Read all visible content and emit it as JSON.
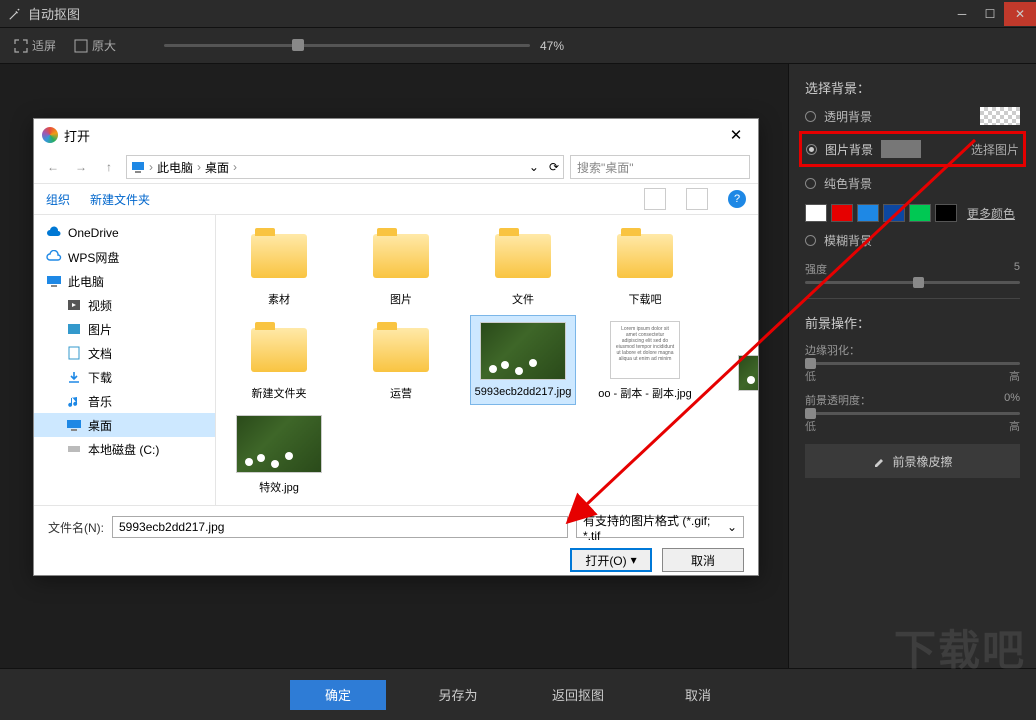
{
  "titlebar": {
    "title": "自动抠图"
  },
  "toolbar": {
    "fit": "适屏",
    "original": "原大",
    "zoom": "47%"
  },
  "sidepanel": {
    "select_bg_label": "选择背景：",
    "transparent": "透明背景",
    "image_bg": "图片背景",
    "select_image_btn": "选择图片",
    "solid_bg": "纯色背景",
    "more_colors": "更多颜色",
    "blur_bg": "模糊背景",
    "intensity_label": "强度",
    "intensity_value": "5",
    "foreground_label": "前景操作：",
    "feather_label": "边缘羽化：",
    "low": "低",
    "high": "高",
    "opacity_label": "前景透明度：",
    "opacity_value": "0%",
    "eraser_btn": "前景橡皮擦",
    "colors": [
      "#ffffff",
      "#e60000",
      "#1e88e5",
      "#0d47a1",
      "#00c853",
      "#000000"
    ]
  },
  "bottombar": {
    "ok": "确定",
    "saveas": "另存为",
    "back": "返回抠图",
    "cancel": "取消"
  },
  "watermark": "下载吧",
  "filedialog": {
    "title": "打开",
    "breadcrumb": [
      "此电脑",
      "桌面"
    ],
    "search_placeholder": "搜索\"桌面\"",
    "organize": "组织",
    "newfolder": "新建文件夹",
    "tree": [
      {
        "label": "OneDrive",
        "icon": "cloud-blue",
        "sub": false
      },
      {
        "label": "WPS网盘",
        "icon": "cloud-outline",
        "sub": false
      },
      {
        "label": "此电脑",
        "icon": "pc",
        "sub": false
      },
      {
        "label": "视频",
        "icon": "video",
        "sub": true
      },
      {
        "label": "图片",
        "icon": "images",
        "sub": true
      },
      {
        "label": "文档",
        "icon": "doc",
        "sub": true
      },
      {
        "label": "下载",
        "icon": "download",
        "sub": true
      },
      {
        "label": "音乐",
        "icon": "music",
        "sub": true
      },
      {
        "label": "桌面",
        "icon": "desktop",
        "sub": true,
        "selected": true
      },
      {
        "label": "本地磁盘 (C:)",
        "icon": "disk",
        "sub": true
      }
    ],
    "files": [
      {
        "name": "素材",
        "type": "folder"
      },
      {
        "name": "图片",
        "type": "folder"
      },
      {
        "name": "文件",
        "type": "folder"
      },
      {
        "name": "下载吧",
        "type": "folder"
      },
      {
        "name": "新建文件夹",
        "type": "folder"
      },
      {
        "name": "运营",
        "type": "folder"
      },
      {
        "name": "5993ecb2dd217.jpg",
        "type": "image",
        "selected": true
      },
      {
        "name": "oo - 副本 - 副本.jpg",
        "type": "doc"
      },
      {
        "name": "特效.jpg",
        "type": "image"
      }
    ],
    "filename_label": "文件名(N):",
    "filename_value": "5993ecb2dd217.jpg",
    "filter": "有支持的图片格式 (*.gif; *.tif",
    "open_btn": "打开(O)",
    "cancel_btn": "取消"
  }
}
